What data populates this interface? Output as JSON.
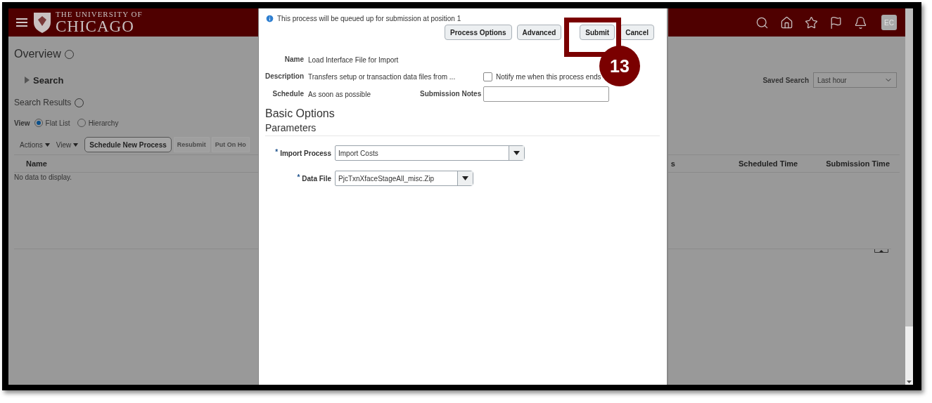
{
  "header": {
    "logo_top": "THE UNIVERSITY OF",
    "logo_bottom": "CHICAGO",
    "avatar": "EC"
  },
  "page": {
    "title": "Overview",
    "search_label": "Search",
    "saved_search": {
      "label": "Saved Search",
      "value": "Last hour"
    },
    "results_title": "Search Results",
    "view": {
      "label": "View",
      "options": [
        {
          "label": "Flat List",
          "selected": true
        },
        {
          "label": "Hierarchy",
          "selected": false
        }
      ]
    },
    "toolbar": {
      "menus": [
        "Actions",
        "View"
      ],
      "buttons": [
        {
          "label": "Schedule New Process",
          "disabled": false
        },
        {
          "label": "Resubmit",
          "disabled": true
        },
        {
          "label": "Put On Ho",
          "disabled": true
        }
      ]
    },
    "table": {
      "left_columns": [
        "Name"
      ],
      "right_columns": [
        "s",
        "Scheduled Time",
        "Submission Time"
      ],
      "empty_text": "No data to display."
    }
  },
  "dialog": {
    "info": "This process will be queued up for submission at position 1",
    "buttons": [
      "Process Options",
      "Advanced",
      "Submit",
      "Cancel"
    ],
    "rows": [
      {
        "label": "Name",
        "value": "Load Interface File for Import"
      },
      {
        "label": "Description",
        "value": "Transfers setup or transaction data files from ...",
        "aside": {
          "kind": "checkbox",
          "label": "Notify me when this process ends",
          "checked": false
        }
      },
      {
        "label": "Schedule",
        "value": "As soon as possible",
        "aside": {
          "kind": "text_field",
          "label": "Submission Notes"
        }
      }
    ],
    "section_title": "Basic Options",
    "subsection_title": "Parameters",
    "parameters": [
      {
        "label": "Import Process",
        "required_mark": "*",
        "value": "Import Costs"
      },
      {
        "label": "Data File",
        "required_mark": "*",
        "value": "PjcTxnXfaceStageAll_misc.Zip"
      }
    ]
  },
  "callout": {
    "number": "13"
  }
}
